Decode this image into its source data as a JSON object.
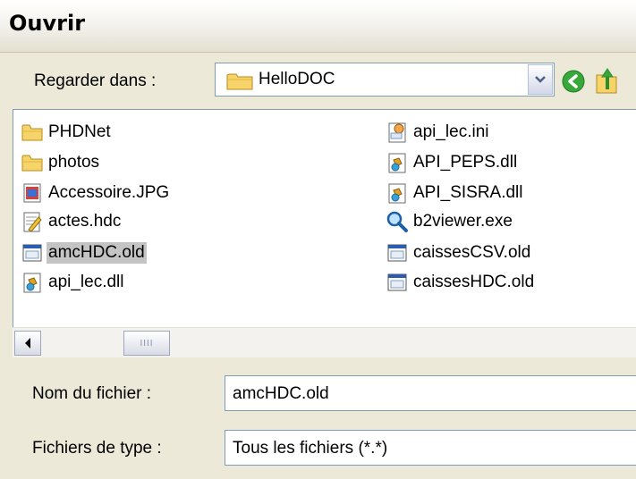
{
  "window": {
    "title": "Ouvrir"
  },
  "look_in": {
    "label": "Regarder dans :",
    "value": "HelloDOC"
  },
  "files": [
    {
      "name": "PHDNet",
      "icon": "folder-icon"
    },
    {
      "name": "photos",
      "icon": "folder-icon"
    },
    {
      "name": "Accessoire.JPG",
      "icon": "image-file-icon"
    },
    {
      "name": "actes.hdc",
      "icon": "document-file-icon"
    },
    {
      "name": "amcHDC.old",
      "icon": "window-file-icon",
      "selected": true
    },
    {
      "name": "api_lec.dll",
      "icon": "dll-file-icon"
    },
    {
      "name": "api_lec.ini",
      "icon": "settings-file-icon"
    },
    {
      "name": "API_PEPS.dll",
      "icon": "dll-file-icon"
    },
    {
      "name": "API_SISRA.dll",
      "icon": "dll-file-icon"
    },
    {
      "name": "b2viewer.exe",
      "icon": "magnifier-exe-icon"
    },
    {
      "name": "caissesCSV.old",
      "icon": "window-file-icon"
    },
    {
      "name": "caissesHDC.old",
      "icon": "window-file-icon"
    }
  ],
  "scrollbar": {
    "thumb_grip": "IIII"
  },
  "filename": {
    "label": "Nom du fichier :",
    "value": "amcHDC.old"
  },
  "filetype": {
    "label": "Fichiers de type :",
    "value": "Tous les fichiers (*.*)"
  }
}
